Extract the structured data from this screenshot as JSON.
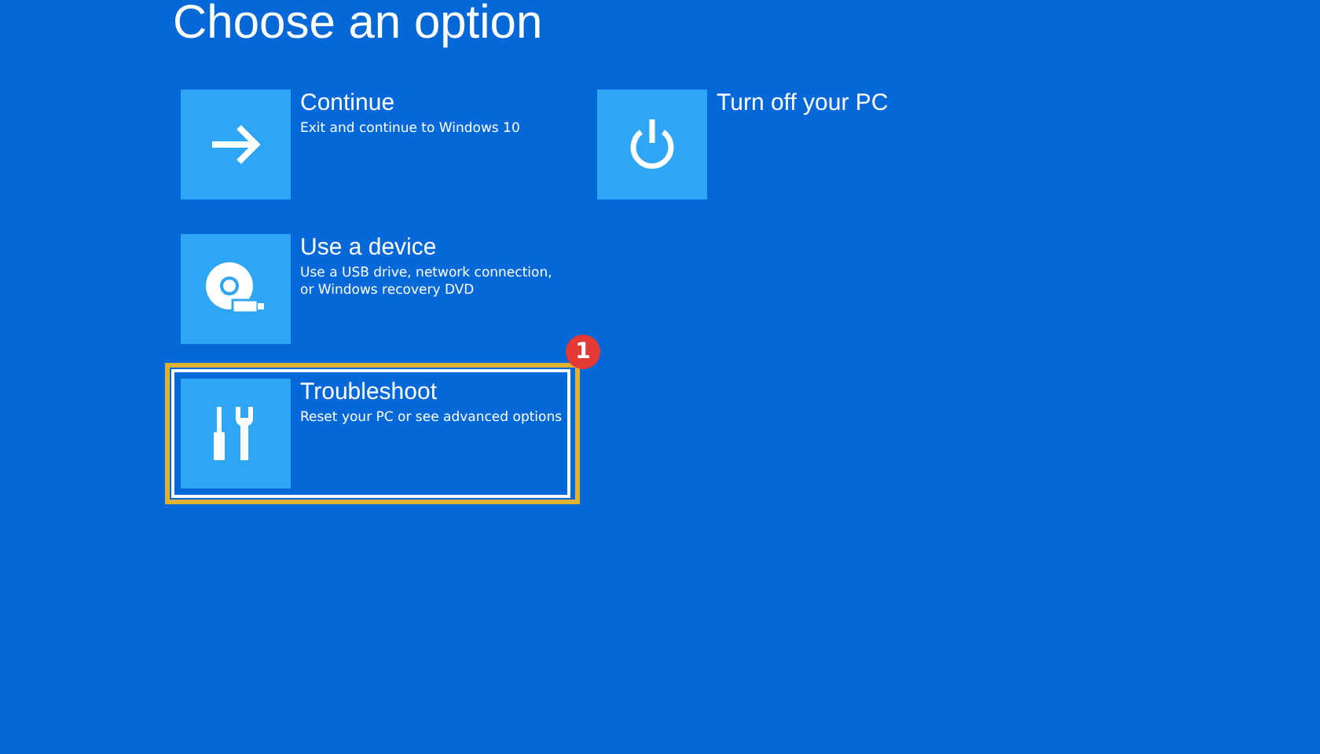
{
  "title": "Choose an option",
  "columns": [
    [
      {
        "kind": "arrow",
        "title": "Continue",
        "description": "Exit and continue to Windows 10",
        "selected": false,
        "highlighted": false
      },
      {
        "kind": "device",
        "title": "Use a device",
        "description": "Use a USB drive, network connection, or Windows recovery DVD",
        "selected": false,
        "highlighted": false
      },
      {
        "kind": "tools",
        "title": "Troubleshoot",
        "description": "Reset your PC or see advanced options",
        "selected": true,
        "highlighted": true,
        "badge": "1"
      }
    ],
    [
      {
        "kind": "power",
        "title": "Turn off your PC",
        "selected": false,
        "highlighted": false
      }
    ]
  ]
}
